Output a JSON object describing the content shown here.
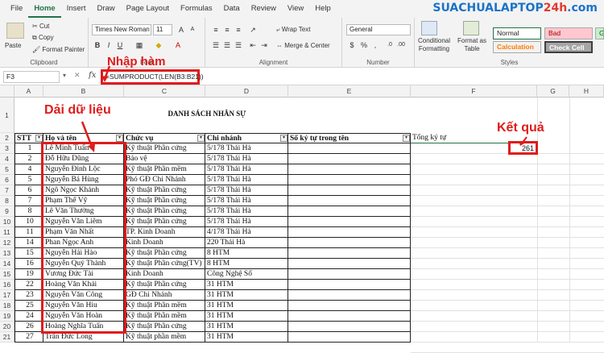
{
  "menu": [
    "File",
    "Home",
    "Insert",
    "Draw",
    "Page Layout",
    "Formulas",
    "Data",
    "Review",
    "View",
    "Help"
  ],
  "active_menu": "Home",
  "logo": {
    "part1": "SUACHUALAPTOP",
    "part2": "24h",
    "part3": ".com"
  },
  "ribbon": {
    "clipboard": {
      "paste": "Paste",
      "cut": "Cut",
      "copy": "Copy",
      "format_painter": "Format Painter",
      "label": "Clipboard"
    },
    "font": {
      "name": "Times New Roman",
      "size": "11",
      "label": "Font"
    },
    "alignment": {
      "wrap": "Wrap Text",
      "merge": "Merge & Center",
      "label": "Alignment"
    },
    "number": {
      "format": "General",
      "label": "Number"
    },
    "styles": {
      "conditional": "Conditional Formatting",
      "format_table": "Format as Table",
      "normal": "Normal",
      "bad": "Bad",
      "good": "Go",
      "calculation": "Calculation",
      "check_cell": "Check Cell",
      "label": "Styles"
    }
  },
  "formula_bar": {
    "name_box": "F3",
    "fx": "fx",
    "formula": "=SUMPRODUCT(LEN(B3:B21))"
  },
  "columns": [
    "A",
    "B",
    "C",
    "D",
    "E",
    "F",
    "G",
    "H"
  ],
  "title": "DANH SÁCH NHÂN SỰ",
  "headers": [
    "STT",
    "Họ và tên",
    "Chức vụ",
    "Chi nhánh",
    "Số ký tự trong tên",
    "Tổng ký tự"
  ],
  "rows": [
    {
      "rn": "3",
      "stt": "1",
      "name": "Lê Minh Tuấn",
      "role": "Kỹ thuật Phần cứng",
      "branch": "5/178 Thái Hà"
    },
    {
      "rn": "4",
      "stt": "2",
      "name": "Đỗ Hữu Dũng",
      "role": "Bảo vệ",
      "branch": "5/178 Thái Hà"
    },
    {
      "rn": "5",
      "stt": "4",
      "name": "Nguyễn Đình Lộc",
      "role": "Kỹ thuật Phần mềm",
      "branch": "5/178 Thái Hà"
    },
    {
      "rn": "6",
      "stt": "5",
      "name": "Nguyễn Bá Hùng",
      "role": "Phó GĐ Chi Nhánh",
      "branch": "5/178 Thái Hà"
    },
    {
      "rn": "7",
      "stt": "6",
      "name": "Ngô Ngọc Khánh",
      "role": "Kỹ thuật Phần cứng",
      "branch": "5/178 Thái Hà"
    },
    {
      "rn": "8",
      "stt": "7",
      "name": "Phạm Thế Vỹ",
      "role": "Kỹ thuật Phần cứng",
      "branch": "5/178 Thái Hà"
    },
    {
      "rn": "9",
      "stt": "8",
      "name": "Lê Văn Thường",
      "role": "Kỹ thuật Phần cứng",
      "branch": "5/178 Thái Hà"
    },
    {
      "rn": "10",
      "stt": "10",
      "name": "Nguyễn Văn Liêm",
      "role": "Kỹ thuật Phần cứng",
      "branch": "5/178 Thái Hà"
    },
    {
      "rn": "11",
      "stt": "11",
      "name": "Phạm Văn Nhất",
      "role": "TP. Kinh Doanh",
      "branch": "4/178 Thái Hà"
    },
    {
      "rn": "12",
      "stt": "14",
      "name": "Phan Ngọc Anh",
      "role": "Kinh Doanh",
      "branch": "220 Thái Hà"
    },
    {
      "rn": "13",
      "stt": "15",
      "name": "Nguyễn Hải Hào",
      "role": "Kỹ thuật Phần cứng",
      "branch": "8 HTM"
    },
    {
      "rn": "14",
      "stt": "16",
      "name": "Nguyễn Quý Thành",
      "role": "Kỹ thuật Phần cứng(TV)",
      "branch": "8 HTM"
    },
    {
      "rn": "15",
      "stt": "19",
      "name": "Vương Đức Tài",
      "role": "Kinh Doanh",
      "branch": "Công Nghệ Số"
    },
    {
      "rn": "16",
      "stt": "22",
      "name": " Hoàng Văn Khải",
      "role": "Kỹ thuật Phần cứng",
      "branch": "31 HTM"
    },
    {
      "rn": "17",
      "stt": "23",
      "name": " Nguyễn Văn Công",
      "role": "GĐ Chi Nhánh",
      "branch": "31 HTM"
    },
    {
      "rn": "18",
      "stt": "25",
      "name": " Nguyễn Văn Hiu",
      "role": "Kỹ thuật Phần mềm",
      "branch": "31 HTM"
    },
    {
      "rn": "19",
      "stt": "24",
      "name": " Nguyễn Văn Hoàn",
      "role": "Kỹ thuật Phần mềm",
      "branch": "31 HTM"
    },
    {
      "rn": "20",
      "stt": "26",
      "name": " Hoàng Nghĩa Tuấn",
      "role": "Kỹ thuật Phần cứng",
      "branch": "31 HTM"
    },
    {
      "rn": "21",
      "stt": "27",
      "name": " Trần Đức Long",
      "role": "Kỹ thuật phần mềm",
      "branch": "31 HTM"
    }
  ],
  "result": "261",
  "annotations": {
    "formula": "Nhập hàm",
    "range": "Dải dữ liệu",
    "result": "Kết quả"
  },
  "accent": "#217346",
  "annotation_color": "#e01b1b"
}
